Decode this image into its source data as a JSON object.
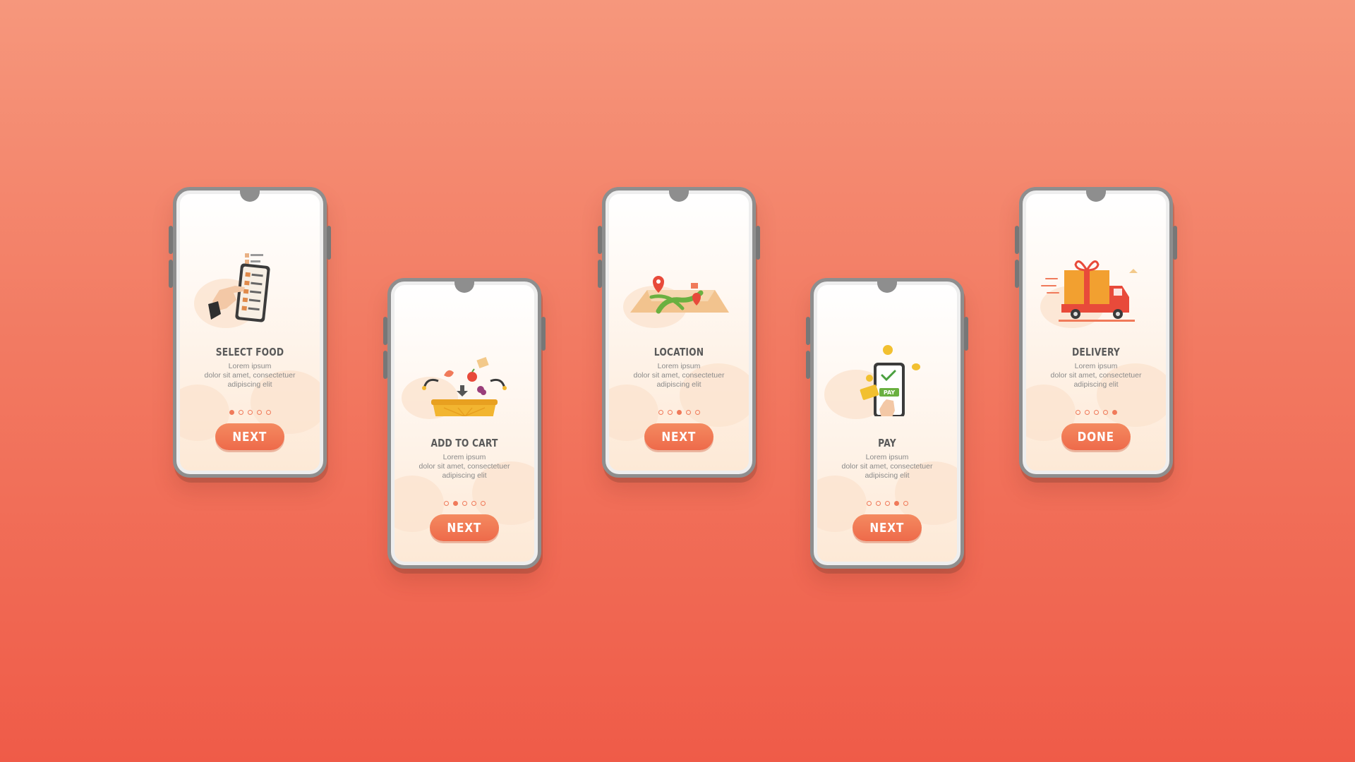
{
  "colors": {
    "background_top": "#f6977c",
    "background_bottom": "#ef5b48",
    "accent": "#f07a5a",
    "title": "#5a5a5a",
    "body_text": "#8a8a8a"
  },
  "screens": [
    {
      "title": "SELECT FOOD",
      "description": [
        "Lorem ipsum",
        "dolor sit amet, consectetuer",
        "adipiscing elit"
      ],
      "active_dot": 1,
      "dot_count": 5,
      "button": "NEXT",
      "icon": "hand-tapping-menu-phone-icon"
    },
    {
      "title": "ADD TO CART",
      "description": [
        "Lorem ipsum",
        "dolor sit amet, consectetuer",
        "adipiscing elit"
      ],
      "active_dot": 2,
      "dot_count": 5,
      "button": "NEXT",
      "icon": "shopping-basket-icon"
    },
    {
      "title": "LOCATION",
      "description": [
        "Lorem ipsum",
        "dolor sit amet, consectetuer",
        "adipiscing elit"
      ],
      "active_dot": 3,
      "dot_count": 5,
      "button": "NEXT",
      "icon": "map-route-pin-icon"
    },
    {
      "title": "PAY",
      "description": [
        "Lorem ipsum",
        "dolor sit amet, consectetuer",
        "adipiscing elit"
      ],
      "active_dot": 4,
      "dot_count": 5,
      "button": "NEXT",
      "icon": "phone-payment-icon",
      "icon_text": "PAY"
    },
    {
      "title": "DELIVERY",
      "description": [
        "Lorem ipsum",
        "dolor sit amet, consectetuer",
        "adipiscing elit"
      ],
      "active_dot": 5,
      "dot_count": 5,
      "button": "DONE",
      "icon": "delivery-truck-gift-icon"
    }
  ]
}
